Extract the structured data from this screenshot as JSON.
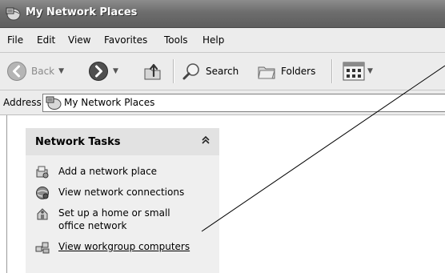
{
  "window": {
    "title": "My Network Places"
  },
  "menu": [
    "File",
    "Edit",
    "View",
    "Favorites",
    "Tools",
    "Help"
  ],
  "toolbar": {
    "back_label": "Back",
    "search_label": "Search",
    "folders_label": "Folders"
  },
  "address": {
    "label": "Address",
    "value": "My Network Places"
  },
  "network_tasks": {
    "title": "Network Tasks",
    "items": [
      {
        "label": "Add a network place",
        "icon": "add-network-place-icon"
      },
      {
        "label": "View network connections",
        "icon": "network-connections-icon"
      },
      {
        "label_line1": "Set up a home or small",
        "label_line2": "office network",
        "icon": "home-network-icon"
      },
      {
        "label": "View workgroup computers",
        "icon": "workgroup-computers-icon"
      }
    ]
  }
}
